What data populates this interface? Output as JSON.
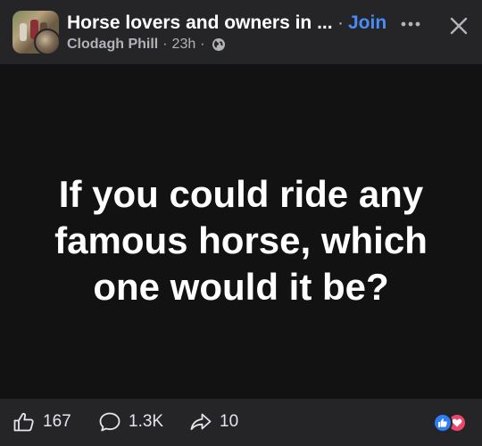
{
  "header": {
    "group_name": "Horse lovers and owners in ...",
    "separator": "·",
    "join_label": "Join",
    "author": "Clodagh Phill",
    "time": "23h",
    "privacy_icon": "globe-icon"
  },
  "post": {
    "text": "If you could ride any famous horse, which one would it be?"
  },
  "footer": {
    "likes": "167",
    "comments": "1.3K",
    "shares": "10",
    "reactions": [
      "like-reaction-icon",
      "love-reaction-icon"
    ]
  },
  "colors": {
    "accent": "#4a8bf5",
    "header_bg": "#252527",
    "post_bg": "#121212",
    "like": "#2e7cf6",
    "love": "#f0456a"
  }
}
